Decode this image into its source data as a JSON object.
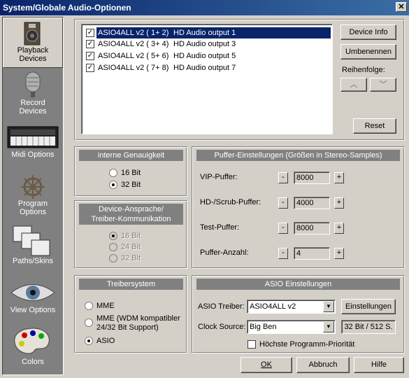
{
  "window": {
    "title": "System/Globale Audio-Optionen",
    "close": "✕"
  },
  "sidebar": [
    {
      "label1": "Playback",
      "label2": "Devices",
      "icon": "speaker-icon",
      "active": true
    },
    {
      "label1": "Record",
      "label2": "Devices",
      "icon": "microphone-icon"
    },
    {
      "label1": "Midi Options",
      "label2": "",
      "icon": "keyboard-icon"
    },
    {
      "label1": "Program",
      "label2": "Options",
      "icon": "helm-icon"
    },
    {
      "label1": "Paths/Skins",
      "label2": "",
      "icon": "folders-icon"
    },
    {
      "label1": "View Options",
      "label2": "",
      "icon": "eye-icon"
    },
    {
      "label1": "Colors",
      "label2": "",
      "icon": "palette-icon"
    }
  ],
  "devices": [
    {
      "name": "ASIO4ALL v2 ( 1+ 2)",
      "output": "HD Audio output 1",
      "checked": true,
      "selected": true
    },
    {
      "name": "ASIO4ALL v2 ( 3+ 4)",
      "output": "HD Audio output 3",
      "checked": true
    },
    {
      "name": "ASIO4ALL v2 ( 5+ 6)",
      "output": "HD Audio output 5",
      "checked": true
    },
    {
      "name": "ASIO4ALL v2 ( 7+ 8)",
      "output": "HD Audio output 7",
      "checked": true
    }
  ],
  "device_buttons": {
    "info": "Device Info",
    "rename": "Umbenennen",
    "order_label": "Reihenfolge:",
    "reset": "Reset",
    "up": "︿",
    "down": "﹀"
  },
  "precision": {
    "title": "interne Genauigkeit",
    "opt16": "16 Bit",
    "opt32": "32 Bit",
    "selected": "32 Bit"
  },
  "device_comm": {
    "title_line1": "Device-Ansprache/",
    "title_line2": "Treiber-Kommunikation",
    "opt16": "16 Bit",
    "opt24": "24 Bit",
    "opt32": "32 Bit"
  },
  "buffers": {
    "title": "Puffer-Einstellungen (Größen in Stereo-Samples)",
    "rows": [
      {
        "label": "VIP-Puffer:",
        "value": "8000"
      },
      {
        "label": "HD-/Scrub-Puffer:",
        "value": "4000"
      },
      {
        "label": "Test-Puffer:",
        "value": "8000"
      },
      {
        "label": "Puffer-Anzahl:",
        "value": "4"
      }
    ],
    "minus": "-",
    "plus": "+"
  },
  "driver_system": {
    "title": "Treibersystem",
    "mme": "MME",
    "wdm_line1": "MME (WDM kompatibler",
    "wdm_line2": "24/32 Bit Support)",
    "asio": "ASIO",
    "selected": "ASIO"
  },
  "asio": {
    "title": "ASIO Einstellungen",
    "driver_label": "ASIO Treiber:",
    "driver_value": "ASIO4ALL v2",
    "settings_button": "Einstellungen",
    "clock_label": "Clock Source:",
    "clock_value": "Big Ben",
    "format": "32 Bit / 512 S.",
    "priority_label": "Höchste Programm-Priorität",
    "priority_checked": false
  },
  "footer": {
    "ok": "OK",
    "cancel": "Abbruch",
    "help": "Hilfe"
  }
}
